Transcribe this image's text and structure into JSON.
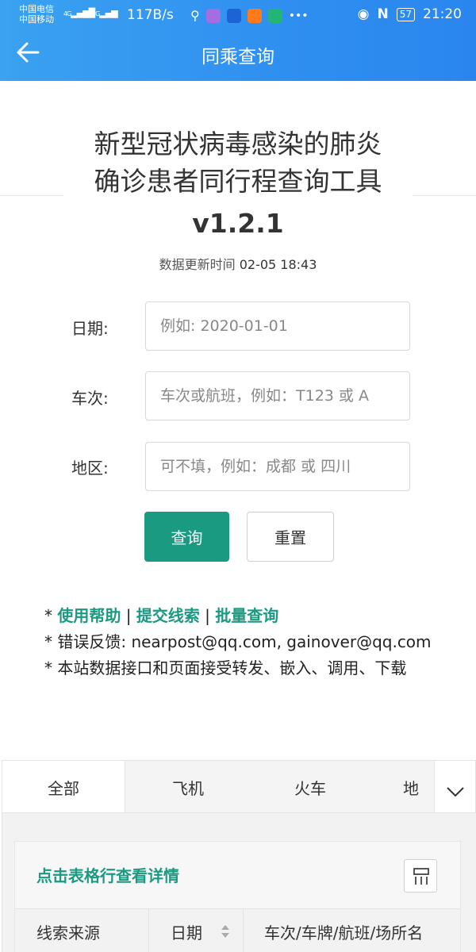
{
  "status_bar": {
    "carrier_1": "中国电信",
    "carrier_2": "中国移动",
    "net_1": "4G",
    "net_2": "2G",
    "speed": "117B/s",
    "battery": "57",
    "time": "21:20"
  },
  "app_bar": {
    "title": "同乘查询"
  },
  "header": {
    "title_line1": "新型冠状病毒感染的肺炎",
    "title_line2": "确诊患者同行程查询工具",
    "version": "v1.2.1",
    "update_label": "数据更新时间",
    "update_time": "02-05 18:43"
  },
  "form": {
    "date_label": "日期:",
    "date_placeholder": "例如: 2020-01-01",
    "train_label": "车次:",
    "train_placeholder": "车次或航班，例如：T123 或 A",
    "region_label": "地区:",
    "region_placeholder": "可不填，例如：成都 或 四川",
    "query_button": "查询",
    "reset_button": "重置"
  },
  "notes": {
    "line1_prefix": "* ",
    "help_link": "使用帮助",
    "sep": " | ",
    "submit_link": "提交线索",
    "batch_link": "批量查询",
    "feedback": "* 错误反馈: nearpost@qq.com, gainover@qq.com",
    "share": "* 本站数据接口和页面接受转发、嵌入、调用、下载"
  },
  "tabs": [
    "全部",
    "飞机",
    "火车",
    "地"
  ],
  "table": {
    "hint": "点击表格行查看详情",
    "columns": [
      "线索来源",
      "日期",
      "车次/车牌/航班/场所名"
    ]
  },
  "colors": {
    "accent": "#1a9a80",
    "appbar": "#2f8ff0"
  }
}
